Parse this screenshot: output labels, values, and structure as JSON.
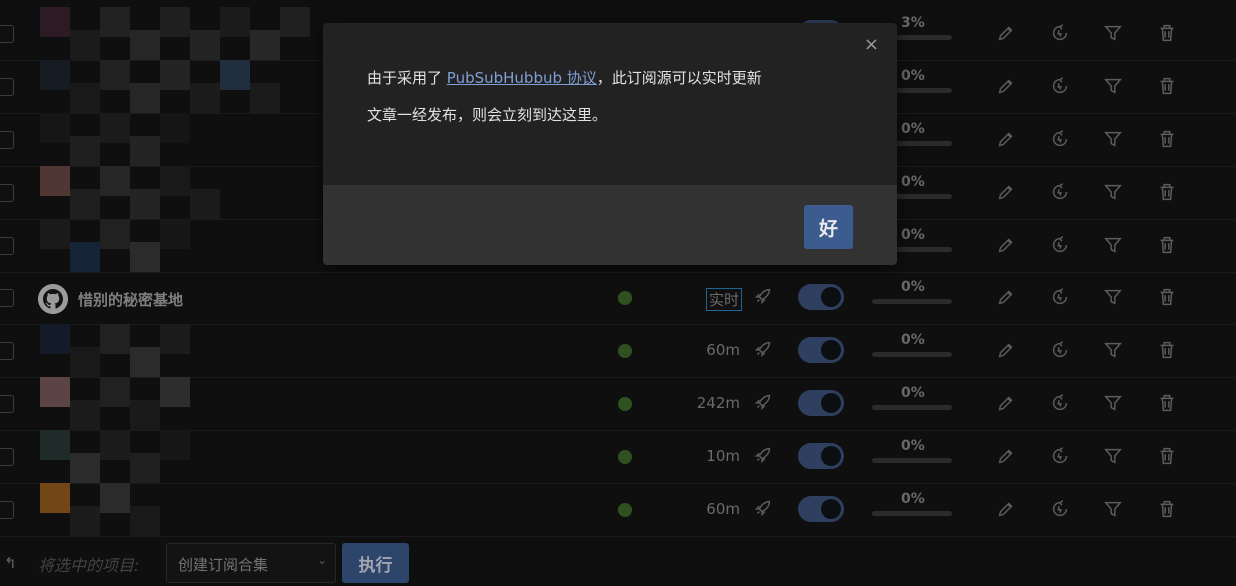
{
  "rows": [
    {
      "name": "",
      "status": "ok",
      "interval": "",
      "live": false,
      "percent": "3%"
    },
    {
      "name": "",
      "status": "ok",
      "interval": "",
      "live": false,
      "percent": "0%"
    },
    {
      "name": "",
      "status": "ok",
      "interval": "",
      "live": false,
      "percent": "0%"
    },
    {
      "name": "",
      "status": "ok",
      "interval": "",
      "live": false,
      "percent": "0%"
    },
    {
      "name": "",
      "status": "ok",
      "interval": "",
      "live": false,
      "percent": "0%"
    },
    {
      "name": "惜别的秘密基地",
      "status": "ok",
      "interval": "实时",
      "live": true,
      "percent": "0%"
    },
    {
      "name": "",
      "status": "ok",
      "interval": "60m",
      "live": false,
      "percent": "0%"
    },
    {
      "name": "",
      "status": "ok",
      "interval": "242m",
      "live": false,
      "percent": "0%"
    },
    {
      "name": "",
      "status": "ok",
      "interval": "10m",
      "live": false,
      "percent": "0%"
    },
    {
      "name": "",
      "status": "ok",
      "interval": "60m",
      "live": false,
      "percent": "0%"
    }
  ],
  "bulk": {
    "label": "将选中的项目:",
    "selected_action": "创建订阅合集",
    "run_label": "执行"
  },
  "dialog": {
    "text_before": "由于采用了 ",
    "link_text": "PubSubHubbub 协议",
    "text_after": "，此订阅源可以实时更新",
    "line2": "文章一经发布，则会立刻到达这里。",
    "close_label": "×",
    "ok_label": "好"
  },
  "colors": {
    "toggle_on": "#3e5580",
    "status_ok": "#3f6d2a",
    "primary_button": "#3c5b8f",
    "link": "#7f9fd6"
  }
}
